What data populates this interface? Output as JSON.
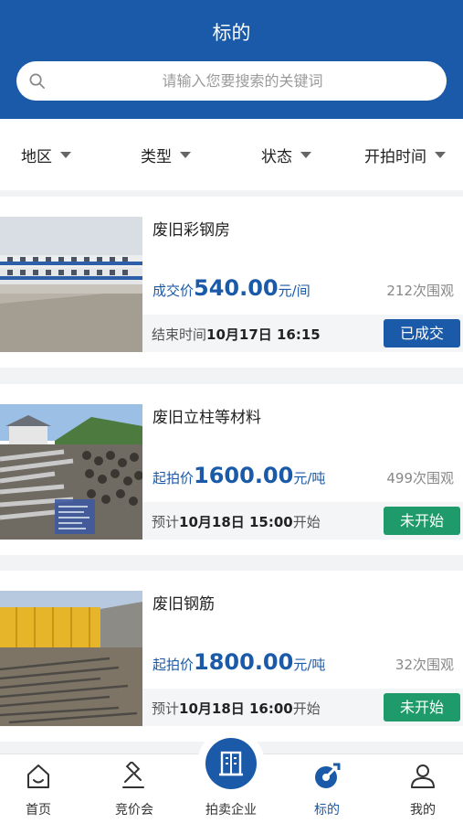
{
  "header": {
    "title": "标的"
  },
  "search": {
    "placeholder": "请输入您要搜索的关键词",
    "icon": "search-icon"
  },
  "filters": [
    {
      "label": "地区"
    },
    {
      "label": "类型"
    },
    {
      "label": "状态"
    },
    {
      "label": "开拍时间"
    }
  ],
  "items": [
    {
      "title": "废旧彩钢房",
      "price_label": "成交价",
      "price": "540.00",
      "unit": "元/间",
      "views": "212次围观",
      "time_prefix": "结束时间",
      "time": "10月17日 16:15",
      "time_suffix": "",
      "badge": "已成交",
      "badge_color": "#1a5aa8"
    },
    {
      "title": "废旧立柱等材料",
      "price_label": "起拍价",
      "price": "1600.00",
      "unit": "元/吨",
      "views": "499次围观",
      "time_prefix": "预计",
      "time": "10月18日 15:00",
      "time_suffix": "开始",
      "badge": "未开始",
      "badge_color": "#1f9a6a"
    },
    {
      "title": "废旧钢筋",
      "price_label": "起拍价",
      "price": "1800.00",
      "unit": "元/吨",
      "views": "32次围观",
      "time_prefix": "预计",
      "time": "10月18日 16:00",
      "time_suffix": "开始",
      "badge": "未开始",
      "badge_color": "#1f9a6a"
    }
  ],
  "tabbar": [
    {
      "label": "首页",
      "icon": "home-icon",
      "active": false
    },
    {
      "label": "竞价会",
      "icon": "gavel-icon",
      "active": false
    },
    {
      "label": "拍卖企业",
      "icon": "building-icon",
      "active": false
    },
    {
      "label": "标的",
      "icon": "target-icon",
      "active": true
    },
    {
      "label": "我的",
      "icon": "user-icon",
      "active": false
    }
  ],
  "colors": {
    "primary": "#1a5aa8",
    "green": "#1f9a6a"
  }
}
